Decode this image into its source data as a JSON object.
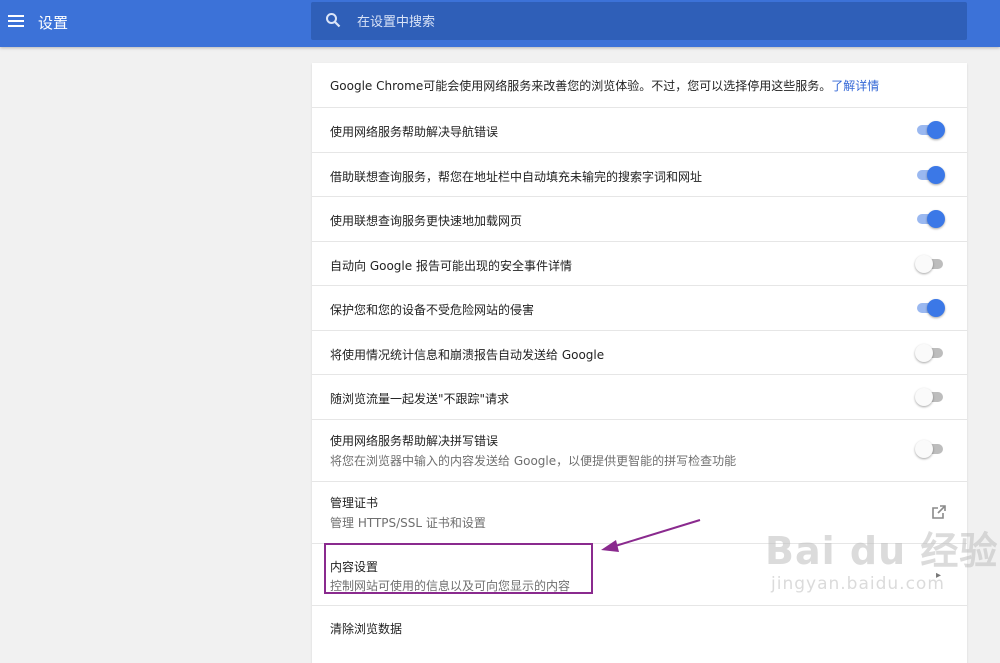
{
  "header": {
    "title": "设置",
    "search_placeholder": "在设置中搜索"
  },
  "intro": {
    "text": "Google Chrome可能会使用网络服务来改善您的浏览体验。不过，您可以选择停用这些服务。",
    "link": "了解详情"
  },
  "settings": [
    {
      "label": "使用网络服务帮助解决导航错误",
      "on": true
    },
    {
      "label": "借助联想查询服务，帮您在地址栏中自动填充未输完的搜索字词和网址",
      "on": true
    },
    {
      "label": "使用联想查询服务更快速地加载网页",
      "on": true
    },
    {
      "label": "自动向 Google 报告可能出现的安全事件详情",
      "on": false
    },
    {
      "label": "保护您和您的设备不受危险网站的侵害",
      "on": true
    },
    {
      "label": "将使用情况统计信息和崩溃报告自动发送给 Google",
      "on": false
    },
    {
      "label": "随浏览流量一起发送\"不跟踪\"请求",
      "on": false
    },
    {
      "label": "使用网络服务帮助解决拼写错误",
      "sub": "将您在浏览器中输入的内容发送给 Google，以便提供更智能的拼写检查功能",
      "on": false
    }
  ],
  "certificates": {
    "label": "管理证书",
    "sub": "管理 HTTPS/SSL 证书和设置"
  },
  "content_settings": {
    "label": "内容设置",
    "sub": "控制网站可使用的信息以及可向您显示的内容"
  },
  "clear_browsing": {
    "label": "清除浏览数据"
  },
  "watermark": {
    "main": "Bai du 经验",
    "sub": "jingyan.baidu.com"
  },
  "colors": {
    "header": "#3c72d8",
    "toggle_on": "#3b78e7",
    "link": "#3367d6",
    "annotation": "#8a2a8e"
  }
}
